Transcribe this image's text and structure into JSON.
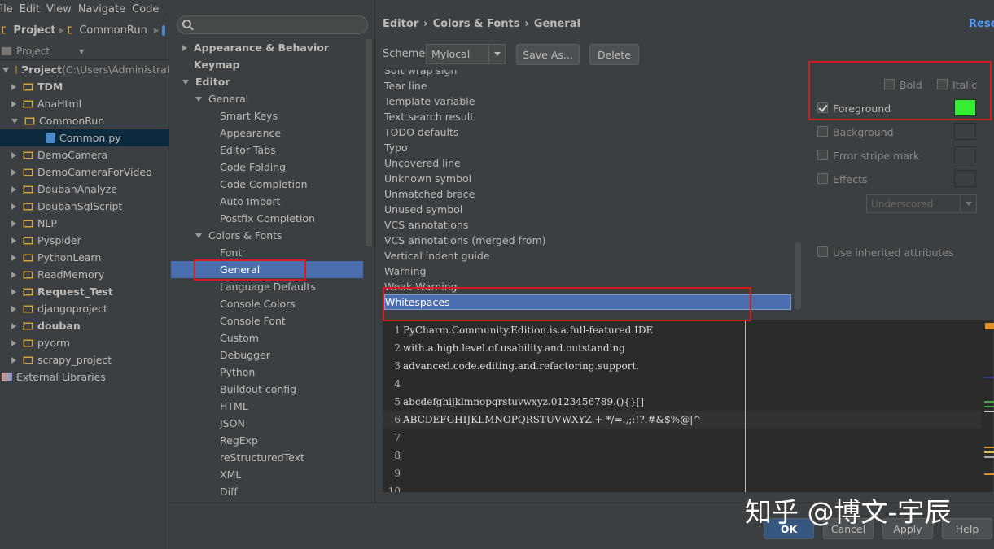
{
  "ide": {
    "menu": [
      "File",
      "Edit",
      "View",
      "Navigate",
      "Code"
    ],
    "nav_project": "Project",
    "nav_crumb": "CommonRun",
    "project_header": "Project",
    "tree": [
      {
        "label": "Project",
        "suffix": " (C:\\Users\\Administrat",
        "bold": true,
        "type": "root",
        "open": true
      },
      {
        "label": "TDM",
        "bold": true,
        "type": "folder"
      },
      {
        "label": "AnaHtml",
        "bold": false,
        "type": "folder"
      },
      {
        "label": "CommonRun",
        "bold": false,
        "type": "folder",
        "open": true
      },
      {
        "label": "Common.py",
        "bold": false,
        "type": "file",
        "selected": true
      },
      {
        "label": "DemoCamera",
        "bold": false,
        "type": "folder"
      },
      {
        "label": "DemoCameraForVideo",
        "bold": false,
        "type": "folder"
      },
      {
        "label": "DoubanAnalyze",
        "bold": false,
        "type": "folder"
      },
      {
        "label": "DoubanSqlScript",
        "bold": false,
        "type": "folder"
      },
      {
        "label": "NLP",
        "bold": false,
        "type": "folder"
      },
      {
        "label": "Pyspider",
        "bold": false,
        "type": "folder"
      },
      {
        "label": "PythonLearn",
        "bold": false,
        "type": "folder"
      },
      {
        "label": "ReadMemory",
        "bold": false,
        "type": "folder"
      },
      {
        "label": "Request_Test",
        "bold": true,
        "type": "folder"
      },
      {
        "label": "djangoproject",
        "bold": false,
        "type": "folder"
      },
      {
        "label": "douban",
        "bold": true,
        "type": "folder"
      },
      {
        "label": "pyorm",
        "bold": false,
        "type": "folder"
      },
      {
        "label": "scrapy_project",
        "bold": false,
        "type": "folder"
      },
      {
        "label": "External Libraries",
        "bold": false,
        "type": "libs"
      }
    ]
  },
  "settings_tree": [
    {
      "label": "Appearance & Behavior",
      "level": 0,
      "arrow": "closed",
      "bold": true
    },
    {
      "label": "Keymap",
      "level": 0,
      "arrow": "none",
      "bold": true
    },
    {
      "label": "Editor",
      "level": 0,
      "arrow": "open",
      "bold": true
    },
    {
      "label": "General",
      "level": 1,
      "arrow": "open"
    },
    {
      "label": "Smart Keys",
      "level": 2
    },
    {
      "label": "Appearance",
      "level": 2
    },
    {
      "label": "Editor Tabs",
      "level": 2
    },
    {
      "label": "Code Folding",
      "level": 2
    },
    {
      "label": "Code Completion",
      "level": 2
    },
    {
      "label": "Auto Import",
      "level": 2
    },
    {
      "label": "Postfix Completion",
      "level": 2
    },
    {
      "label": "Colors & Fonts",
      "level": 1,
      "arrow": "open"
    },
    {
      "label": "Font",
      "level": 2
    },
    {
      "label": "General",
      "level": 2,
      "selected": true
    },
    {
      "label": "Language Defaults",
      "level": 2
    },
    {
      "label": "Console Colors",
      "level": 2
    },
    {
      "label": "Console Font",
      "level": 2
    },
    {
      "label": "Custom",
      "level": 2
    },
    {
      "label": "Debugger",
      "level": 2
    },
    {
      "label": "Python",
      "level": 2
    },
    {
      "label": "Buildout config",
      "level": 2
    },
    {
      "label": "HTML",
      "level": 2
    },
    {
      "label": "JSON",
      "level": 2
    },
    {
      "label": "RegExp",
      "level": 2
    },
    {
      "label": "reStructuredText",
      "level": 2
    },
    {
      "label": "XML",
      "level": 2
    },
    {
      "label": "Diff",
      "level": 2
    }
  ],
  "breadcrumb": [
    "Editor",
    "Colors & Fonts",
    "General"
  ],
  "breadcrumb_sep": "›",
  "reset_label": "Reset",
  "scheme": {
    "label": "Scheme:",
    "value": "Mylocal",
    "save_as": "Save As...",
    "delete": "Delete"
  },
  "attributes": [
    "Soft wrap sign",
    "Tear line",
    "Template variable",
    "Text search result",
    "TODO defaults",
    "Typo",
    "Uncovered line",
    "Unknown symbol",
    "Unmatched brace",
    "Unused symbol",
    "VCS annotations",
    "VCS annotations (merged from)",
    "Vertical indent guide",
    "Warning",
    "Weak Warning",
    "Whitespaces"
  ],
  "selected_attribute": "Whitespaces",
  "options": {
    "bold": "Bold",
    "italic": "Italic",
    "foreground": "Foreground",
    "background": "Background",
    "error_stripe": "Error stripe mark",
    "effects": "Effects",
    "effect_type": "Underscored",
    "use_inherited": "Use inherited attributes",
    "foreground_checked": true,
    "foreground_color": "#33ee33"
  },
  "preview_lines": [
    {
      "n": "1",
      "text": "PyCharm.Community.Edition.is.a.full-featured.IDE"
    },
    {
      "n": "2",
      "text": "with.a.high.level.of.usability.and.outstanding"
    },
    {
      "n": "3",
      "text": "advanced.code.editing.and.refactoring.support."
    },
    {
      "n": "4",
      "text": ""
    },
    {
      "n": "5",
      "text": "abcdefghijklmnopqrstuvwxyz.0123456789.(){}[]"
    },
    {
      "n": "6",
      "text": "ABCDEFGHIJKLMNOPQRSTUVWXYZ.+-*/=.,;:!?.#&$%@|^"
    },
    {
      "n": "7",
      "text": ""
    },
    {
      "n": "8",
      "text": ""
    },
    {
      "n": "9",
      "text": ""
    },
    {
      "n": "10",
      "text": ""
    }
  ],
  "buttons": {
    "ok": "OK",
    "cancel": "Cancel",
    "apply": "Apply",
    "help": "Help"
  },
  "watermark": "知乎 @博文-宇辰"
}
